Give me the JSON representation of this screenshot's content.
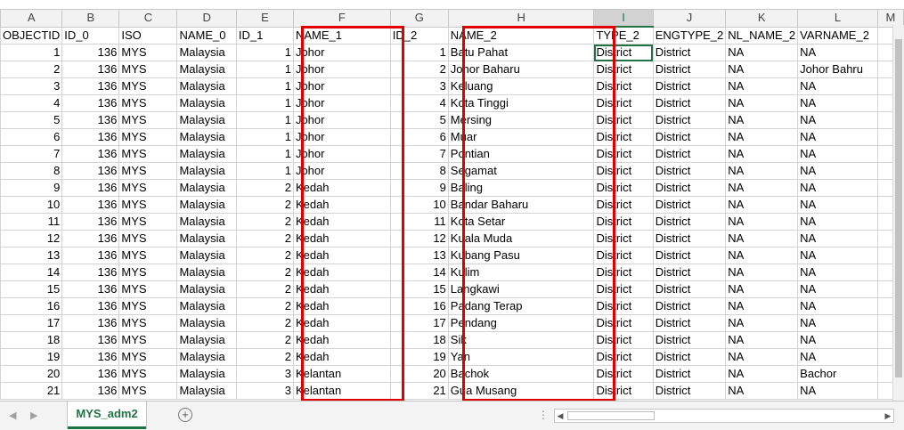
{
  "columns": [
    "A",
    "B",
    "C",
    "D",
    "E",
    "F",
    "G",
    "H",
    "I",
    "J",
    "K",
    "L",
    "M"
  ],
  "selected_column": "I",
  "headers": [
    "OBJECTID",
    "ID_0",
    "ISO",
    "NAME_0",
    "ID_1",
    "NAME_1",
    "ID_2",
    "NAME_2",
    "TYPE_2",
    "ENGTYPE_2",
    "NL_NAME_2",
    "VARNAME_2",
    ""
  ],
  "rows": [
    [
      "1",
      "136",
      "MYS",
      "Malaysia",
      "1",
      "Johor",
      "1",
      "Batu Pahat",
      "District",
      "District",
      "NA",
      "NA",
      ""
    ],
    [
      "2",
      "136",
      "MYS",
      "Malaysia",
      "1",
      "Johor",
      "2",
      "Johor Baharu",
      "District",
      "District",
      "NA",
      "Johor Bahru",
      ""
    ],
    [
      "3",
      "136",
      "MYS",
      "Malaysia",
      "1",
      "Johor",
      "3",
      "Keluang",
      "District",
      "District",
      "NA",
      "NA",
      ""
    ],
    [
      "4",
      "136",
      "MYS",
      "Malaysia",
      "1",
      "Johor",
      "4",
      "Kota Tinggi",
      "District",
      "District",
      "NA",
      "NA",
      ""
    ],
    [
      "5",
      "136",
      "MYS",
      "Malaysia",
      "1",
      "Johor",
      "5",
      "Mersing",
      "District",
      "District",
      "NA",
      "NA",
      ""
    ],
    [
      "6",
      "136",
      "MYS",
      "Malaysia",
      "1",
      "Johor",
      "6",
      "Muar",
      "District",
      "District",
      "NA",
      "NA",
      ""
    ],
    [
      "7",
      "136",
      "MYS",
      "Malaysia",
      "1",
      "Johor",
      "7",
      "Pontian",
      "District",
      "District",
      "NA",
      "NA",
      ""
    ],
    [
      "8",
      "136",
      "MYS",
      "Malaysia",
      "1",
      "Johor",
      "8",
      "Segamat",
      "District",
      "District",
      "NA",
      "NA",
      ""
    ],
    [
      "9",
      "136",
      "MYS",
      "Malaysia",
      "2",
      "Kedah",
      "9",
      "Baling",
      "District",
      "District",
      "NA",
      "NA",
      ""
    ],
    [
      "10",
      "136",
      "MYS",
      "Malaysia",
      "2",
      "Kedah",
      "10",
      "Bandar Baharu",
      "District",
      "District",
      "NA",
      "NA",
      ""
    ],
    [
      "11",
      "136",
      "MYS",
      "Malaysia",
      "2",
      "Kedah",
      "11",
      "Kota Setar",
      "District",
      "District",
      "NA",
      "NA",
      ""
    ],
    [
      "12",
      "136",
      "MYS",
      "Malaysia",
      "2",
      "Kedah",
      "12",
      "Kuala Muda",
      "District",
      "District",
      "NA",
      "NA",
      ""
    ],
    [
      "13",
      "136",
      "MYS",
      "Malaysia",
      "2",
      "Kedah",
      "13",
      "Kubang Pasu",
      "District",
      "District",
      "NA",
      "NA",
      ""
    ],
    [
      "14",
      "136",
      "MYS",
      "Malaysia",
      "2",
      "Kedah",
      "14",
      "Kulim",
      "District",
      "District",
      "NA",
      "NA",
      ""
    ],
    [
      "15",
      "136",
      "MYS",
      "Malaysia",
      "2",
      "Kedah",
      "15",
      "Langkawi",
      "District",
      "District",
      "NA",
      "NA",
      ""
    ],
    [
      "16",
      "136",
      "MYS",
      "Malaysia",
      "2",
      "Kedah",
      "16",
      "Padang Terap",
      "District",
      "District",
      "NA",
      "NA",
      ""
    ],
    [
      "17",
      "136",
      "MYS",
      "Malaysia",
      "2",
      "Kedah",
      "17",
      "Pendang",
      "District",
      "District",
      "NA",
      "NA",
      ""
    ],
    [
      "18",
      "136",
      "MYS",
      "Malaysia",
      "2",
      "Kedah",
      "18",
      "Sik",
      "District",
      "District",
      "NA",
      "NA",
      ""
    ],
    [
      "19",
      "136",
      "MYS",
      "Malaysia",
      "2",
      "Kedah",
      "19",
      "Yan",
      "District",
      "District",
      "NA",
      "NA",
      ""
    ],
    [
      "20",
      "136",
      "MYS",
      "Malaysia",
      "3",
      "Kelantan",
      "20",
      "Bachok",
      "District",
      "District",
      "NA",
      "Bachor",
      ""
    ],
    [
      "21",
      "136",
      "MYS",
      "Malaysia",
      "3",
      "Kelantan",
      "21",
      "Gua Musang",
      "District",
      "District",
      "NA",
      "NA",
      ""
    ]
  ],
  "numeric_columns": [
    0,
    1,
    4,
    6
  ],
  "highlighted_columns": [
    "F",
    "H"
  ],
  "highlight_color": "#e00000",
  "accent_color": "#217346",
  "sheet_tab": {
    "label": "MYS_adm2"
  },
  "icons": {
    "add_sheet": "plus-circle-icon",
    "nav_prev": "triangle-left-icon",
    "nav_next": "triangle-right-icon"
  }
}
